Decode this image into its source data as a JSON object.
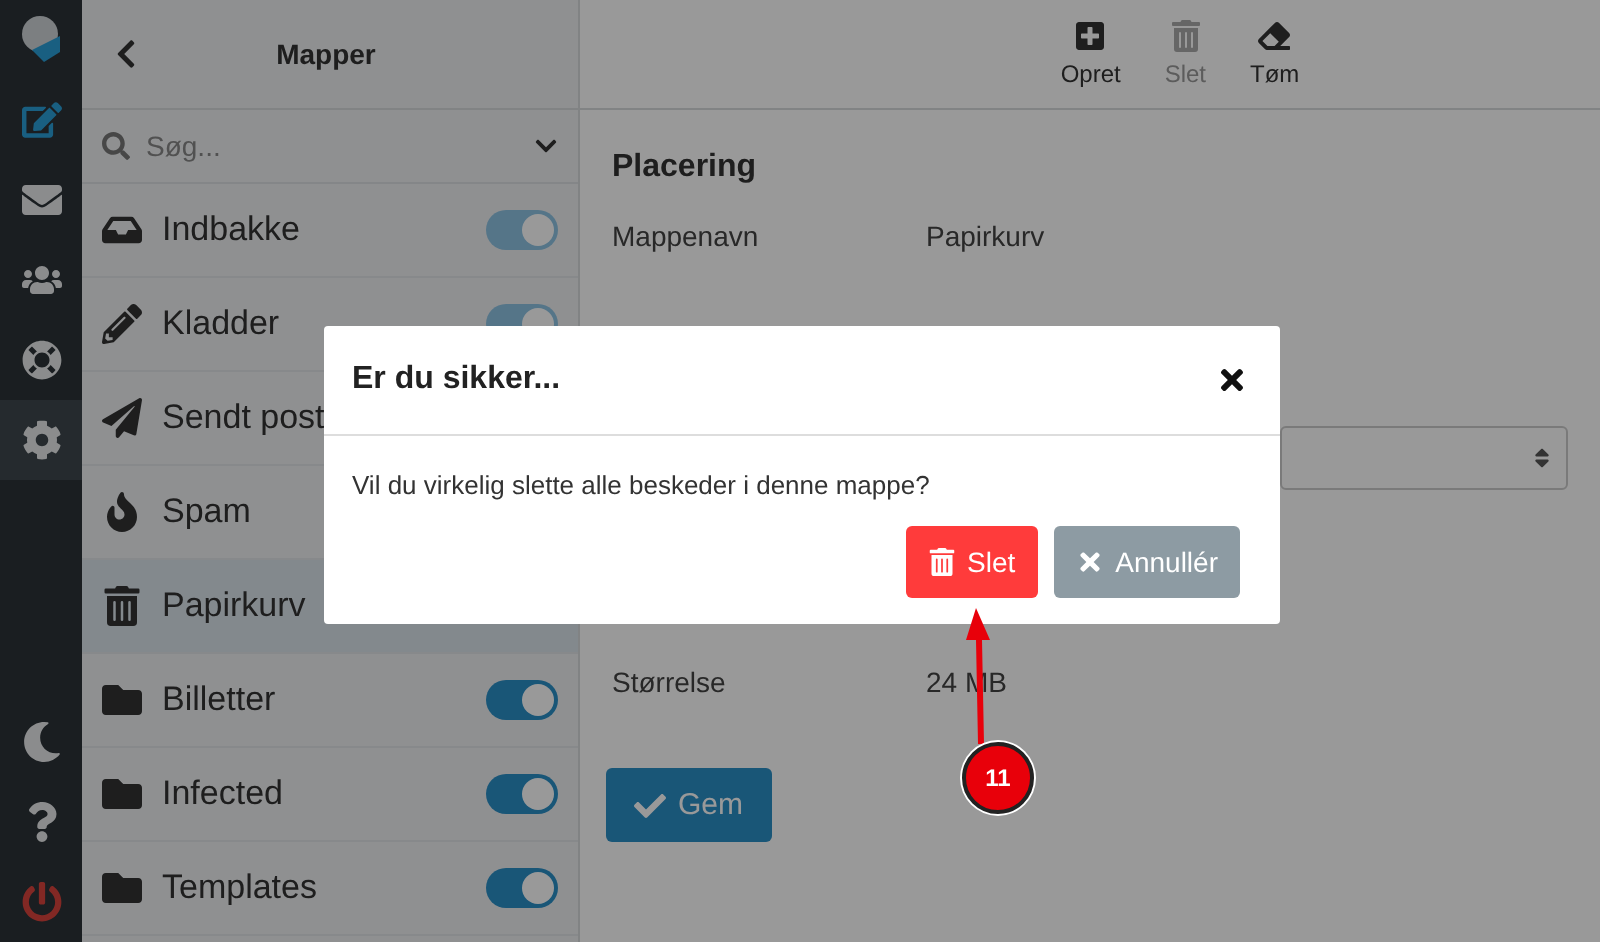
{
  "rail": {
    "items": [
      {
        "selected": false
      },
      {
        "selected": false
      },
      {
        "selected": false
      },
      {
        "selected": false
      },
      {
        "selected": true
      }
    ]
  },
  "sidebar": {
    "title": "Mapper",
    "search": {
      "placeholder": "Søg..."
    },
    "folders": [
      {
        "label": "Indbakke",
        "selected": false,
        "toggle": {
          "on": true,
          "disabled": true
        }
      },
      {
        "label": "Kladder",
        "selected": false,
        "toggle": {
          "on": true,
          "disabled": true
        }
      },
      {
        "label": "Sendt post",
        "selected": false
      },
      {
        "label": "Spam",
        "selected": false
      },
      {
        "label": "Papirkurv",
        "selected": true
      },
      {
        "label": "Billetter",
        "selected": false,
        "toggle": {
          "on": true,
          "disabled": false
        }
      },
      {
        "label": "Infected",
        "selected": false,
        "toggle": {
          "on": true,
          "disabled": false
        }
      },
      {
        "label": "Templates",
        "selected": false,
        "toggle": {
          "on": true,
          "disabled": false
        }
      }
    ]
  },
  "toolbar": [
    {
      "label": "Opret",
      "disabled": false
    },
    {
      "label": "Slet",
      "disabled": true
    },
    {
      "label": "Tøm",
      "disabled": false
    }
  ],
  "main": {
    "heading": "Placering",
    "name_row": {
      "label": "Mappenavn",
      "value": "Papirkurv"
    },
    "size_row": {
      "label": "Størrelse",
      "value": "24 MB"
    },
    "save_button": "Gem"
  },
  "dialog": {
    "title": "Er du sikker...",
    "message": "Vil du virkelig slette alle beskeder i denne mappe?",
    "buttons": [
      {
        "kind": "danger",
        "label": "Slet"
      },
      {
        "kind": "cancel",
        "label": "Annullér"
      }
    ]
  },
  "annotation": {
    "badge": "11"
  }
}
